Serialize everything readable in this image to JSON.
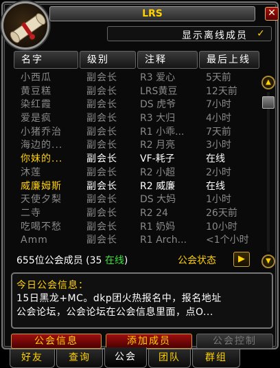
{
  "window": {
    "title": "LRS",
    "close_icon": "✕"
  },
  "offline_toggle": {
    "label": "显示离线成员",
    "checked_icon": "✓"
  },
  "columns": [
    "名字",
    "级别",
    "注释",
    "最后上线"
  ],
  "members": [
    {
      "name": "小西瓜",
      "rank": "副会长",
      "note": "R3 爱心",
      "last": "5天前",
      "online": false
    },
    {
      "name": "黄豆糕",
      "rank": "副会长",
      "note": "LRS黄豆",
      "last": "12天前",
      "online": false
    },
    {
      "name": "染红霞",
      "rank": "副会长",
      "note": "DS 虎爷",
      "last": "7小时",
      "online": false
    },
    {
      "name": "爱是疯",
      "rank": "副会长",
      "note": "R3 大归",
      "last": "4小时",
      "online": false
    },
    {
      "name": "小猪乔治",
      "rank": "副会长",
      "note": "R1 小乖...",
      "last": "7天前",
      "online": false
    },
    {
      "name": "海边的...",
      "rank": "副会长",
      "note": "R2 月亮",
      "last": "3小时",
      "online": false
    },
    {
      "name": "你妹的...",
      "rank": "副会长",
      "note": "VF-耗子",
      "last": "在线",
      "online": true
    },
    {
      "name": "沐莲",
      "rank": "副会长",
      "note": "R2 小超",
      "last": "2小时",
      "online": false
    },
    {
      "name": "威廉姆斯",
      "rank": "副会长",
      "note": "R2 威廉",
      "last": "在线",
      "online": true
    },
    {
      "name": "天使夕梨",
      "rank": "副会长",
      "note": "DS 大妈",
      "last": "1小时",
      "online": false
    },
    {
      "name": "二寺",
      "rank": "副会长",
      "note": "R2 24",
      "last": "26天前",
      "online": false
    },
    {
      "name": "吃喝不愁",
      "rank": "副会长",
      "note": "R1 奶妈",
      "last": "10小时",
      "online": false
    },
    {
      "name": "Amm",
      "rank": "副会长",
      "note": "R1 Arch...",
      "last": "<1个小时",
      "online": false
    }
  ],
  "summary": {
    "count_text": "655位公会成员 (35 ",
    "online_text": "在线",
    "close_paren": ")"
  },
  "status": {
    "label": "公会状态",
    "arrow_icon": "▶"
  },
  "motd": {
    "title": "今日公会信息：",
    "line1": "15日黑龙+MC。dkp团火热报名中，报名地址",
    "line2": "公会论坛，公会论坛在公会信息里面，点O..."
  },
  "buttons": {
    "guild_info": "公会信息",
    "add_member": "添加成员",
    "guild_control": "公会控制"
  },
  "tabs": [
    "好友",
    "查询",
    "公会",
    "团队",
    "群组"
  ],
  "scroll": {
    "up_icon": "▲",
    "down_icon": "▼"
  }
}
